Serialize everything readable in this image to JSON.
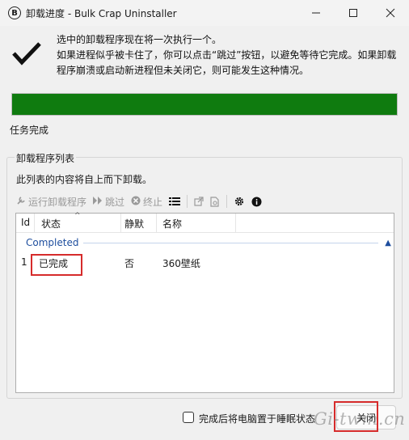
{
  "window": {
    "title": "卸载进度 - Bulk Crap Uninstaller",
    "app_icon_letter": "B"
  },
  "message": {
    "line1": "选中的卸载程序现在将一次执行一个。",
    "line2": "如果进程似乎被卡住了，你可以点击“跳过”按钮，以避免等待它完成。如果卸载程序崩溃或启动新进程但未关闭它，则可能发生这种情况。"
  },
  "progress": {
    "percent": 100,
    "color": "#0f7b0f"
  },
  "task_status": "任务完成",
  "group": {
    "title": "卸载程序列表",
    "description": "此列表的内容将自上而下卸载。"
  },
  "toolbar": {
    "run_label": "运行卸载程序",
    "skip_label": "跳过",
    "stop_label": "终止"
  },
  "list": {
    "columns": {
      "id": "Id",
      "status": "状态",
      "silent": "静默",
      "name": "名称"
    },
    "group_label": "Completed",
    "rows": [
      {
        "id": "1",
        "status": "已完成",
        "silent": "否",
        "name": "360壁纸"
      }
    ]
  },
  "footer": {
    "sleep_label": "完成后将电脑置于睡眠状态",
    "close_label": "关闭"
  },
  "watermark": "Gi-twm.cn",
  "colors": {
    "highlight": "#d62b2b",
    "progress": "#0f7b0f",
    "group_text": "#1e4e9e"
  }
}
